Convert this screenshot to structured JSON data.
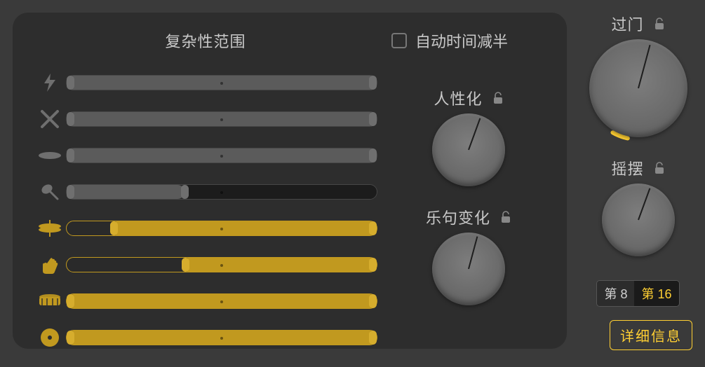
{
  "titles": {
    "complexity": "复杂性范围",
    "autoHalf": "自动时间减半",
    "humanize": "人性化",
    "phraseVar": "乐句变化",
    "fills": "过门",
    "swing": "摇摆"
  },
  "sliders": [
    {
      "icon": "lightning",
      "active": false,
      "from": 0,
      "to": 100,
      "overlay": null,
      "handleMid": null
    },
    {
      "icon": "sticks",
      "active": false,
      "from": 0,
      "to": 100,
      "overlay": null,
      "handleMid": null
    },
    {
      "icon": "cymbal",
      "active": false,
      "from": 0,
      "to": 100,
      "overlay": null,
      "handleMid": null
    },
    {
      "icon": "shaker",
      "active": false,
      "from": 0,
      "to": 38,
      "overlay": {
        "from": 38,
        "to": 100
      },
      "handleMid": 38
    },
    {
      "icon": "hihat",
      "active": true,
      "from": 14,
      "to": 100,
      "overlay": null,
      "handleMid": null
    },
    {
      "icon": "clap",
      "active": true,
      "from": 37,
      "to": 100,
      "overlay": null,
      "handleMid": null
    },
    {
      "icon": "snare",
      "active": true,
      "from": 0,
      "to": 100,
      "overlay": null,
      "handleMid": null
    },
    {
      "icon": "kick",
      "active": true,
      "from": 0,
      "to": 100,
      "overlay": null,
      "handleMid": null
    }
  ],
  "knobs": {
    "humanize": {
      "angle": 200
    },
    "phraseVar": {
      "angle": 195
    },
    "fills": {
      "angle": 195,
      "arc": 18
    },
    "swing": {
      "angle": 200
    }
  },
  "segmented": {
    "opt1": "第 8",
    "opt2": "第 16",
    "active": "opt2"
  },
  "buttons": {
    "details": "详细信息"
  },
  "checkboxes": {
    "autoHalf": false
  },
  "colors": {
    "accent": "#ffcf33",
    "sliderYellow": "#c1991f",
    "sliderGray": "#5b5b5b"
  }
}
